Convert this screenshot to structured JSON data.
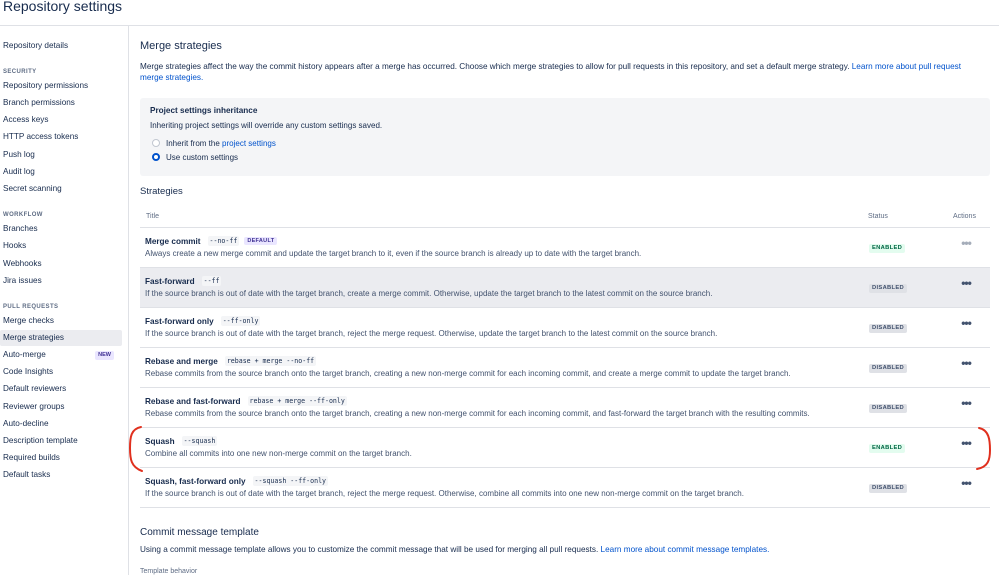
{
  "header": {
    "title": "Repository settings"
  },
  "sidebar": {
    "top_items": [
      {
        "label": "Repository details"
      }
    ],
    "sections": [
      {
        "label": "SECURITY",
        "items": [
          "Repository permissions",
          "Branch permissions",
          "Access keys",
          "HTTP access tokens",
          "Push log",
          "Audit log",
          "Secret scanning"
        ]
      },
      {
        "label": "WORKFLOW",
        "items": [
          "Branches",
          "Hooks",
          "Webhooks",
          "Jira issues"
        ]
      },
      {
        "label": "PULL REQUESTS",
        "items": [
          "Merge checks",
          "Merge strategies",
          "Auto-merge",
          "Code Insights",
          "Default reviewers",
          "Reviewer groups",
          "Auto-decline",
          "Description template",
          "Required builds",
          "Default tasks"
        ]
      }
    ],
    "active_item": "Merge strategies",
    "new_badge": "NEW"
  },
  "main": {
    "title": "Merge strategies",
    "description": "Merge strategies affect the way the commit history appears after a merge has occurred. Choose which merge strategies to allow for pull requests in this repository, and set a default merge strategy.",
    "description_link_1": "Learn more about pull request",
    "description_link_2": "merge strategies.",
    "inheritance": {
      "title": "Project settings inheritance",
      "desc": "Inheriting project settings will override any custom settings saved.",
      "option_inherit_prefix": "Inherit from the ",
      "option_inherit_link": "project settings",
      "option_custom": "Use custom settings",
      "selected": "custom"
    },
    "strategies_title": "Strategies",
    "table_headers": {
      "title": "Title",
      "status": "Status",
      "actions": "Actions"
    },
    "strategies": [
      {
        "name": "Merge commit",
        "flag": "--no-ff",
        "default": "DEFAULT",
        "desc": "Always create a new merge commit and update the target branch to it, even if the source branch is already up to date with the target branch.",
        "status": "ENABLED"
      },
      {
        "name": "Fast-forward",
        "flag": "--ff",
        "default": "",
        "desc": "If the source branch is out of date with the target branch, create a merge commit. Otherwise, update the target branch to the latest commit on the source branch.",
        "status": "DISABLED"
      },
      {
        "name": "Fast-forward only",
        "flag": "--ff-only",
        "default": "",
        "desc": "If the source branch is out of date with the target branch, reject the merge request. Otherwise, update the target branch to the latest commit on the source branch.",
        "status": "DISABLED"
      },
      {
        "name": "Rebase and merge",
        "flag": "rebase + merge --no-ff",
        "default": "",
        "desc": "Rebase commits from the source branch onto the target branch, creating a new non-merge commit for each incoming commit, and create a merge commit to update the target branch.",
        "status": "DISABLED"
      },
      {
        "name": "Rebase and fast-forward",
        "flag": "rebase + merge --ff-only",
        "default": "",
        "desc": "Rebase commits from the source branch onto the target branch, creating a new non-merge commit for each incoming commit, and fast-forward the target branch with the resulting commits.",
        "status": "DISABLED"
      },
      {
        "name": "Squash",
        "flag": "--squash",
        "default": "",
        "desc": "Combine all commits into one new non-merge commit on the target branch.",
        "status": "ENABLED"
      },
      {
        "name": "Squash, fast-forward only",
        "flag": "--squash --ff-only",
        "default": "",
        "desc": "If the source branch is out of date with the target branch, reject the merge request. Otherwise, combine all commits into one new non-merge commit on the target branch.",
        "status": "DISABLED"
      }
    ],
    "commit_template": {
      "title": "Commit message template",
      "desc": "Using a commit message template allows you to customize the commit message that will be used for merging all pull requests.",
      "link": "Learn more about commit message templates.",
      "behavior_label": "Template behavior"
    }
  },
  "colors": {
    "link": "#0052cc",
    "annotation": "#e0301e",
    "enabled": "#006644",
    "disabled": "#42526e"
  }
}
